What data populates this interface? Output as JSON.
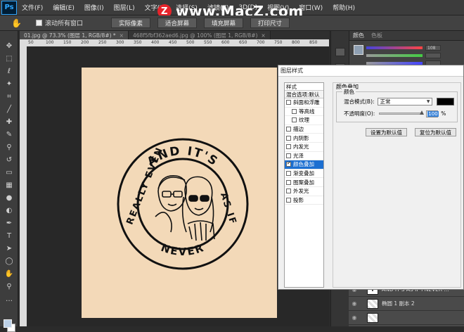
{
  "app": {
    "logo": "Ps"
  },
  "menubar": {
    "items": [
      "文件(F)",
      "编辑(E)",
      "图像(I)",
      "图层(L)",
      "文字(Y)",
      "选择(S)",
      "滤镜(T)",
      "3D(D)",
      "视图(V)",
      "窗口(W)",
      "帮助(H)"
    ]
  },
  "watermark": {
    "logo": "Z",
    "text": "www.MacZ.com"
  },
  "options_bar": {
    "hand_icon": "hand-icon",
    "scroll_all_label": "滚动所有窗口",
    "buttons": [
      "实际像素",
      "适合屏幕",
      "填充屏幕",
      "打印尺寸"
    ]
  },
  "tabs": [
    {
      "label": "01.jpg @ 73.3% (图层 1, RGB/8#) *",
      "close": "×"
    },
    {
      "label": "468f5fbf362aed6.jpg @ 100% (图层 1, RGB/8#)",
      "close": "×"
    }
  ],
  "ruler": {
    "marks": [
      "50",
      "100",
      "150",
      "200",
      "250",
      "300",
      "350",
      "400",
      "450",
      "500",
      "550",
      "600",
      "650",
      "700",
      "750",
      "800",
      "850"
    ]
  },
  "stamp": {
    "top_text": "AND IT'S",
    "left_text": "REALLY EVEN",
    "right_text": "AS IF",
    "bottom_text": "NEVER"
  },
  "panel": {
    "tabs": [
      "颜色",
      "色板"
    ],
    "values": [
      "108",
      "",
      "",
      ""
    ]
  },
  "layers": [
    {
      "name": "AND IT'S AS IF I NEVER ...",
      "thumb": "T"
    },
    {
      "name": "椭圆 1 副本 2",
      "thumb": ""
    },
    {
      "name": "",
      "thumb": ""
    }
  ],
  "dialog": {
    "title": "图层样式",
    "left_header": "样式",
    "left_subheader": "混合选项:默认",
    "styles": [
      {
        "label": "斜面和浮雕",
        "checked": false,
        "sub": false
      },
      {
        "label": "等高线",
        "checked": false,
        "sub": true
      },
      {
        "label": "纹理",
        "checked": false,
        "sub": true
      },
      {
        "label": "描边",
        "checked": false,
        "sub": false
      },
      {
        "label": "内阴影",
        "checked": false,
        "sub": false
      },
      {
        "label": "内发光",
        "checked": false,
        "sub": false
      },
      {
        "label": "光泽",
        "checked": false,
        "sub": false
      },
      {
        "label": "颜色叠加",
        "checked": true,
        "sub": false,
        "active": true
      },
      {
        "label": "渐变叠加",
        "checked": false,
        "sub": false
      },
      {
        "label": "图案叠加",
        "checked": false,
        "sub": false
      },
      {
        "label": "外发光",
        "checked": false,
        "sub": false
      },
      {
        "label": "投影",
        "checked": false,
        "sub": false
      }
    ],
    "group_title": "颜色叠加",
    "legend": "颜色",
    "blend_mode_label": "混合模式(B):",
    "blend_mode_value": "正常",
    "overlay_color": "#000000",
    "opacity_label": "不透明度(O):",
    "opacity_value": "100",
    "opacity_unit": "%",
    "btn_default": "设置为默认值",
    "btn_reset": "复位为默认值"
  }
}
